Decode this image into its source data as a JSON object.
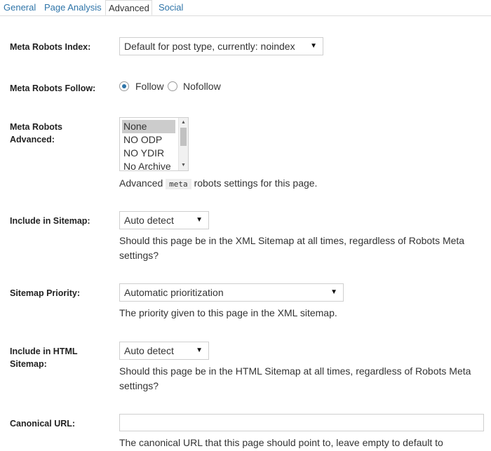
{
  "tabs": [
    "General",
    "Page Analysis",
    "Advanced",
    "Social"
  ],
  "active_tab": "Advanced",
  "fields": {
    "meta_robots_index": {
      "label": "Meta Robots Index:",
      "value": "Default for post type, currently: noindex"
    },
    "meta_robots_follow": {
      "label": "Meta Robots Follow:",
      "options": [
        "Follow",
        "Nofollow"
      ],
      "selected": "Follow"
    },
    "meta_robots_advanced": {
      "label_line1": "Meta Robots",
      "label_line2": "Advanced:",
      "options": [
        "None",
        "NO ODP",
        "NO YDIR",
        "No Archive"
      ],
      "selected": "None",
      "desc_pre": "Advanced",
      "desc_code": "meta",
      "desc_post": "robots settings for this page."
    },
    "include_in_sitemap": {
      "label": "Include in Sitemap:",
      "value": "Auto detect",
      "desc": "Should this page be in the XML Sitemap at all times, regardless of Robots Meta settings?"
    },
    "sitemap_priority": {
      "label": "Sitemap Priority:",
      "value": "Automatic prioritization",
      "desc": "The priority given to this page in the XML sitemap."
    },
    "include_in_html_sitemap": {
      "label_line1": "Include in HTML",
      "label_line2": "Sitemap:",
      "value": "Auto detect",
      "desc": "Should this page be in the HTML Sitemap at all times, regardless of Robots Meta settings?"
    },
    "canonical_url": {
      "label": "Canonical URL:",
      "value": "",
      "desc": "The canonical URL that this page should point to, leave empty to default to"
    }
  },
  "icons": {
    "dropdown": "triangle-down-icon",
    "scroll_up": "triangle-up-icon",
    "scroll_down": "triangle-down-icon"
  },
  "colors": {
    "link": "#2e74a8",
    "radio_selected": "#2e74a8",
    "list_selected": "#cccccc"
  }
}
